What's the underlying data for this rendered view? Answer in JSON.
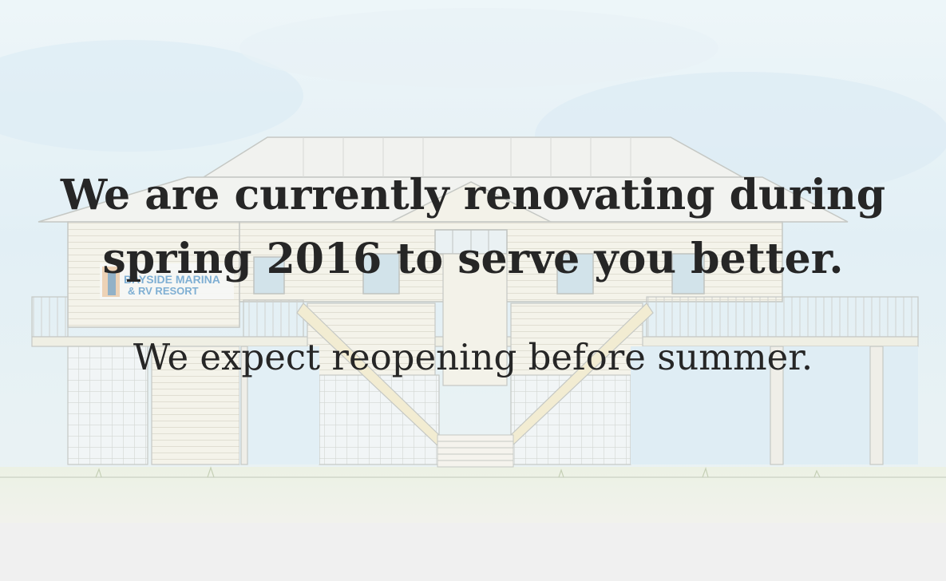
{
  "announcement": {
    "headline_line1": "We are currently renovating during",
    "headline_line2": "spring 2016 to serve you better.",
    "subline": "We expect reopening before summer."
  },
  "sign": {
    "line1": "BAYSIDE MARINA",
    "line2": "& RV RESORT"
  },
  "colors": {
    "sky": "#dcecf3",
    "ground": "#e9eee2",
    "text": "#262626",
    "sketch_line": "#b9bcb8",
    "sign_blue": "#4a8fc4"
  }
}
